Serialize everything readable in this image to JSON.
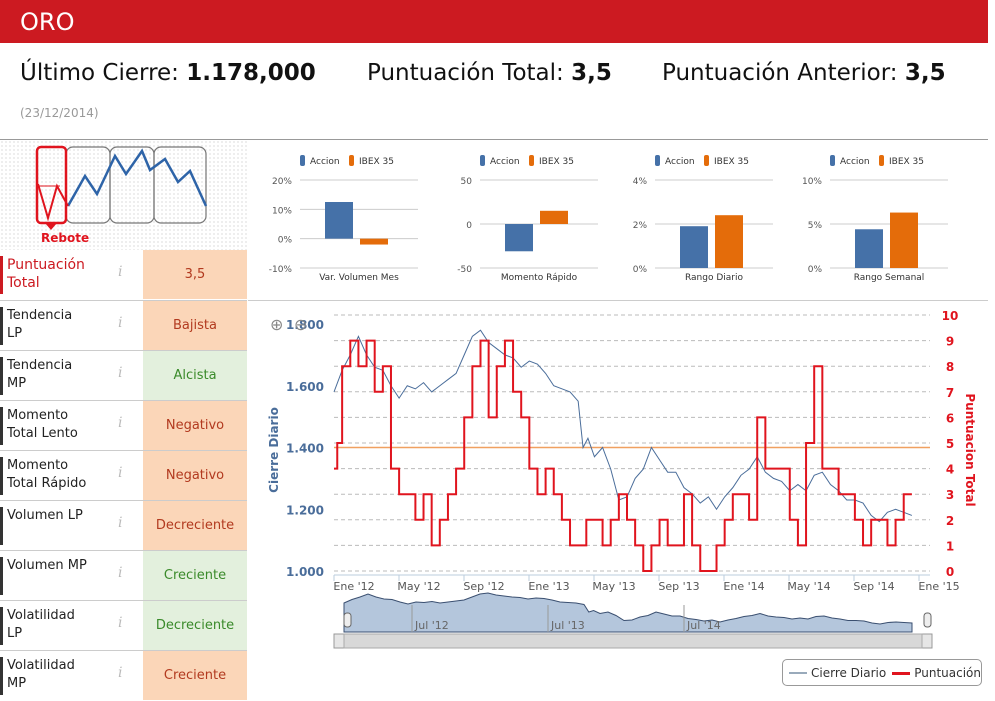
{
  "title": "ORO",
  "summary": {
    "last_close_label": "Último Cierre:",
    "last_close_value": "1.178,000",
    "total_label": "Puntuación Total:",
    "total_value": "3,5",
    "prev_label": "Puntuación Anterior:",
    "prev_value": "3,5",
    "date": "(23/12/2014)"
  },
  "pattern": {
    "label": "Rebote"
  },
  "rows": [
    {
      "label": "Puntuación Total",
      "value": "3,5",
      "tone": "peach",
      "highlight": true
    },
    {
      "label": "Tendencia LP",
      "value": "Bajista",
      "tone": "peach"
    },
    {
      "label": "Tendencia MP",
      "value": "Alcista",
      "tone": "green"
    },
    {
      "label": "Momento Total Lento",
      "value": "Negativo",
      "tone": "peach"
    },
    {
      "label": "Momento Total Rápido",
      "value": "Negativo",
      "tone": "peach"
    },
    {
      "label": "Volumen LP",
      "value": "Decreciente",
      "tone": "peach"
    },
    {
      "label": "Volumen MP",
      "value": "Creciente",
      "tone": "green"
    },
    {
      "label": "Volatilidad LP",
      "value": "Decreciente",
      "tone": "green"
    },
    {
      "label": "Volatilidad MP",
      "value": "Creciente",
      "tone": "peach"
    }
  ],
  "info_icon": "i",
  "colors": {
    "accion": "#4571a8",
    "ibex": "#e46c0a",
    "price": "#4a6d9a",
    "score": "#e0141e",
    "brand": "#cc1a21"
  },
  "chart_data": [
    {
      "type": "bar",
      "title": "Var. Volumen Mes",
      "legend": [
        "Accion",
        "IBEX 35"
      ],
      "ticks": [
        "20%",
        "10%",
        "0%",
        "-10%"
      ],
      "ylim": [
        -10,
        20
      ],
      "values": [
        12.5,
        -2
      ]
    },
    {
      "type": "bar",
      "title": "Momento Rápido",
      "legend": [
        "Accion",
        "IBEX 35"
      ],
      "ticks": [
        "50",
        "0",
        "-50"
      ],
      "ylim": [
        -50,
        50
      ],
      "values": [
        -31,
        15
      ]
    },
    {
      "type": "bar",
      "title": "Rango Diario",
      "legend": [
        "Accion",
        "IBEX 35"
      ],
      "ticks": [
        "4%",
        "2%",
        "0%"
      ],
      "ylim": [
        0,
        4
      ],
      "values": [
        1.9,
        2.4
      ]
    },
    {
      "type": "bar",
      "title": "Rango Semanal",
      "legend": [
        "Accion",
        "IBEX 35"
      ],
      "ticks": [
        "10%",
        "5%",
        "0%"
      ],
      "ylim": [
        0,
        10
      ],
      "values": [
        4.4,
        6.3
      ]
    },
    {
      "type": "line",
      "ylabel": "Cierre Diario",
      "y2label": "Puntuacion Total",
      "yticks": [
        "1.800",
        "1.600",
        "1.400",
        "1.200",
        "1.000"
      ],
      "ylim": [
        1000,
        1800
      ],
      "y2ticks": [
        "10",
        "9",
        "8",
        "7",
        "6",
        "5",
        "4",
        "3",
        "2",
        "1",
        "0"
      ],
      "y2lim": [
        0,
        10
      ],
      "xticks": [
        "Ene '12",
        "May '12",
        "Sep '12",
        "Ene '13",
        "May '13",
        "Sep '13",
        "Ene '14",
        "May '14",
        "Sep '14",
        "Ene '15"
      ],
      "reference_line": 1400,
      "navigator_labels": [
        "Jul '12",
        "Jul '13",
        "Jul '14"
      ],
      "legend": [
        "Cierre Diario",
        "Puntuación"
      ],
      "price": [
        [
          0,
          1580
        ],
        [
          0.5,
          1650
        ],
        [
          1,
          1700
        ],
        [
          1.5,
          1760
        ],
        [
          2,
          1700
        ],
        [
          2.5,
          1660
        ],
        [
          3,
          1650
        ],
        [
          3.5,
          1600
        ],
        [
          4,
          1560
        ],
        [
          4.5,
          1600
        ],
        [
          5,
          1590
        ],
        [
          5.5,
          1610
        ],
        [
          6,
          1580
        ],
        [
          6.5,
          1600
        ],
        [
          7,
          1620
        ],
        [
          7.5,
          1640
        ],
        [
          8,
          1700
        ],
        [
          8.5,
          1760
        ],
        [
          9,
          1780
        ],
        [
          9.5,
          1740
        ],
        [
          10,
          1720
        ],
        [
          10.5,
          1700
        ],
        [
          11,
          1690
        ],
        [
          11.5,
          1660
        ],
        [
          12,
          1680
        ],
        [
          12.5,
          1670
        ],
        [
          13,
          1640
        ],
        [
          13.5,
          1600
        ],
        [
          14,
          1590
        ],
        [
          14.5,
          1580
        ],
        [
          15,
          1550
        ],
        [
          15.3,
          1400
        ],
        [
          15.6,
          1430
        ],
        [
          16,
          1370
        ],
        [
          16.5,
          1400
        ],
        [
          17,
          1330
        ],
        [
          17.5,
          1230
        ],
        [
          18,
          1240
        ],
        [
          18.5,
          1300
        ],
        [
          19,
          1330
        ],
        [
          19.5,
          1400
        ],
        [
          20,
          1360
        ],
        [
          20.5,
          1320
        ],
        [
          21,
          1320
        ],
        [
          21.5,
          1270
        ],
        [
          22,
          1250
        ],
        [
          22.5,
          1220
        ],
        [
          23,
          1240
        ],
        [
          23.5,
          1200
        ],
        [
          24,
          1240
        ],
        [
          24.5,
          1270
        ],
        [
          25,
          1310
        ],
        [
          25.5,
          1330
        ],
        [
          26,
          1370
        ],
        [
          26.5,
          1320
        ],
        [
          27,
          1300
        ],
        [
          27.5,
          1290
        ],
        [
          28,
          1260
        ],
        [
          28.5,
          1280
        ],
        [
          29,
          1260
        ],
        [
          29.5,
          1310
        ],
        [
          30,
          1320
        ],
        [
          30.5,
          1280
        ],
        [
          31,
          1260
        ],
        [
          31.5,
          1230
        ],
        [
          32,
          1230
        ],
        [
          32.5,
          1220
        ],
        [
          33,
          1180
        ],
        [
          33.5,
          1160
        ],
        [
          34,
          1190
        ],
        [
          34.5,
          1200
        ],
        [
          35,
          1190
        ],
        [
          35.5,
          1180
        ]
      ],
      "score": [
        [
          0,
          4
        ],
        [
          0.2,
          5
        ],
        [
          0.5,
          8
        ],
        [
          1,
          9
        ],
        [
          1.5,
          8
        ],
        [
          2,
          9
        ],
        [
          2.5,
          7
        ],
        [
          3,
          8
        ],
        [
          3.5,
          4
        ],
        [
          4,
          3
        ],
        [
          5,
          2
        ],
        [
          5.5,
          3
        ],
        [
          6,
          1
        ],
        [
          6.5,
          2
        ],
        [
          7,
          3
        ],
        [
          7.5,
          4
        ],
        [
          8,
          6
        ],
        [
          8.5,
          8
        ],
        [
          9,
          9
        ],
        [
          9.5,
          6
        ],
        [
          10,
          8
        ],
        [
          10.5,
          9
        ],
        [
          11,
          7
        ],
        [
          11.5,
          6
        ],
        [
          12,
          4
        ],
        [
          12.5,
          3
        ],
        [
          13,
          4
        ],
        [
          13.5,
          3
        ],
        [
          14,
          2
        ],
        [
          14.5,
          1
        ],
        [
          15,
          1
        ],
        [
          15.5,
          2
        ],
        [
          16,
          2
        ],
        [
          16.5,
          1
        ],
        [
          17,
          2
        ],
        [
          17.5,
          3
        ],
        [
          18,
          2
        ],
        [
          18.5,
          1
        ],
        [
          19,
          0
        ],
        [
          19.5,
          1
        ],
        [
          20,
          2
        ],
        [
          20.5,
          1
        ],
        [
          21,
          1
        ],
        [
          21.5,
          3
        ],
        [
          22,
          1
        ],
        [
          22.5,
          0
        ],
        [
          23,
          0
        ],
        [
          23.5,
          1
        ],
        [
          24,
          2
        ],
        [
          24.5,
          3
        ],
        [
          25,
          3
        ],
        [
          25.5,
          2
        ],
        [
          26,
          6
        ],
        [
          26.5,
          4
        ],
        [
          27,
          4
        ],
        [
          28,
          2
        ],
        [
          28.5,
          1
        ],
        [
          29,
          5
        ],
        [
          29.5,
          8
        ],
        [
          30,
          4
        ],
        [
          30.5,
          4
        ],
        [
          31,
          3
        ],
        [
          31.5,
          3
        ],
        [
          32,
          2
        ],
        [
          32.5,
          1
        ],
        [
          33,
          2
        ],
        [
          34,
          1
        ],
        [
          34.5,
          2
        ],
        [
          35,
          3
        ],
        [
          35.5,
          3
        ]
      ]
    }
  ]
}
